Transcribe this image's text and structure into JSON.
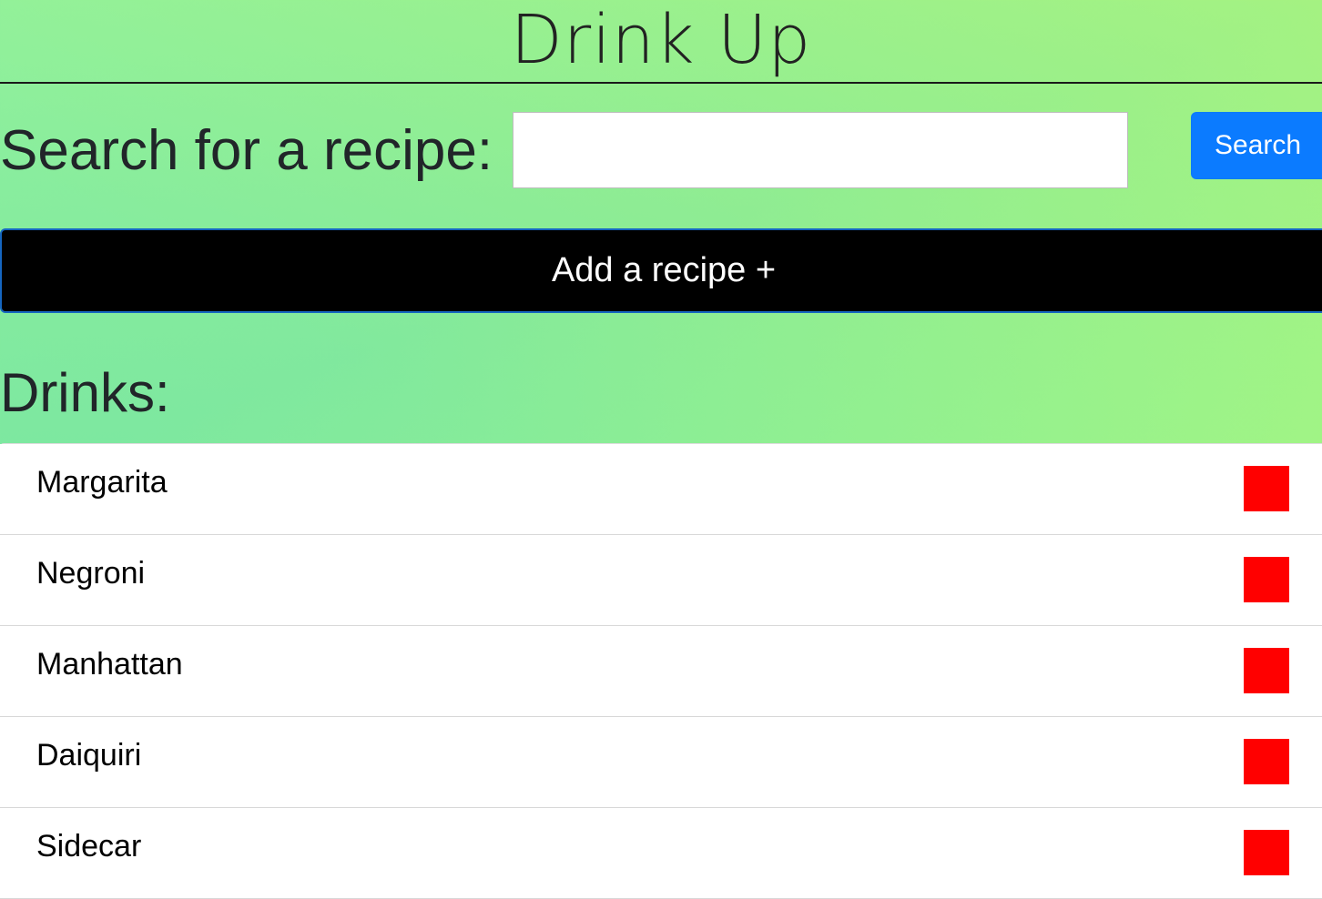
{
  "app": {
    "title": "Drink Up"
  },
  "search": {
    "label": "Search for a recipe:",
    "value": "",
    "placeholder": "",
    "button_label": "Search"
  },
  "add_recipe": {
    "label": "Add a recipe +"
  },
  "drinks": {
    "heading": "Drinks:",
    "items": [
      {
        "name": "Margarita"
      },
      {
        "name": "Negroni"
      },
      {
        "name": "Manhattan"
      },
      {
        "name": "Daiquiri"
      },
      {
        "name": "Sidecar"
      }
    ]
  },
  "colors": {
    "accent": "#0b7bff",
    "delete": "#ff0000",
    "add_button_bg": "#000000",
    "background_gradient": [
      "#7de6a0",
      "#b5f777"
    ]
  }
}
